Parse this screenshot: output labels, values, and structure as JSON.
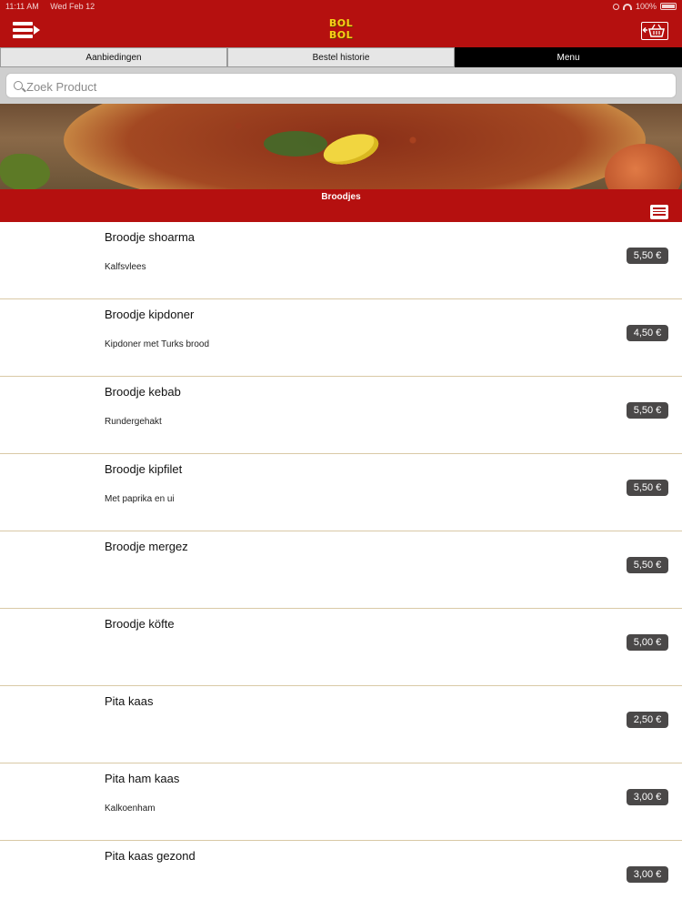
{
  "status_bar": {
    "time": "11:11 AM",
    "date": "Wed Feb 12",
    "battery": "100%"
  },
  "header": {
    "logo_line1": "BOL",
    "logo_line2": "BOL",
    "menu_icon": "menu-arrow-icon",
    "cart_icon": "basket-icon"
  },
  "tabs": [
    {
      "label": "Aanbiedingen"
    },
    {
      "label": "Bestel historie"
    },
    {
      "label": "Menu"
    }
  ],
  "search": {
    "placeholder": "Zoek Product"
  },
  "category": {
    "title": "Broodjes"
  },
  "items": [
    {
      "name": "Broodje shoarma",
      "description": "Kalfsvlees",
      "price": "5,50 €"
    },
    {
      "name": "Broodje kipdoner",
      "description": "Kipdoner met Turks brood",
      "price": "4,50 €"
    },
    {
      "name": "Broodje kebab",
      "description": "Rundergehakt",
      "price": "5,50 €"
    },
    {
      "name": "Broodje kipfilet",
      "description": "Met paprika en ui",
      "price": "5,50 €"
    },
    {
      "name": "Broodje mergez",
      "description": "",
      "price": "5,50 €"
    },
    {
      "name": "Broodje köfte",
      "description": "",
      "price": "5,00 €"
    },
    {
      "name": "Pita kaas",
      "description": "",
      "price": "2,50 €"
    },
    {
      "name": "Pita ham kaas",
      "description": "Kalkoenham",
      "price": "3,00 €"
    },
    {
      "name": "Pita kaas gezond",
      "description": "",
      "price": "3,00 €"
    }
  ],
  "colors": {
    "brand_red": "#b5100f",
    "price_badge": "#4a4848",
    "logo_yellow": "#f7d117"
  }
}
